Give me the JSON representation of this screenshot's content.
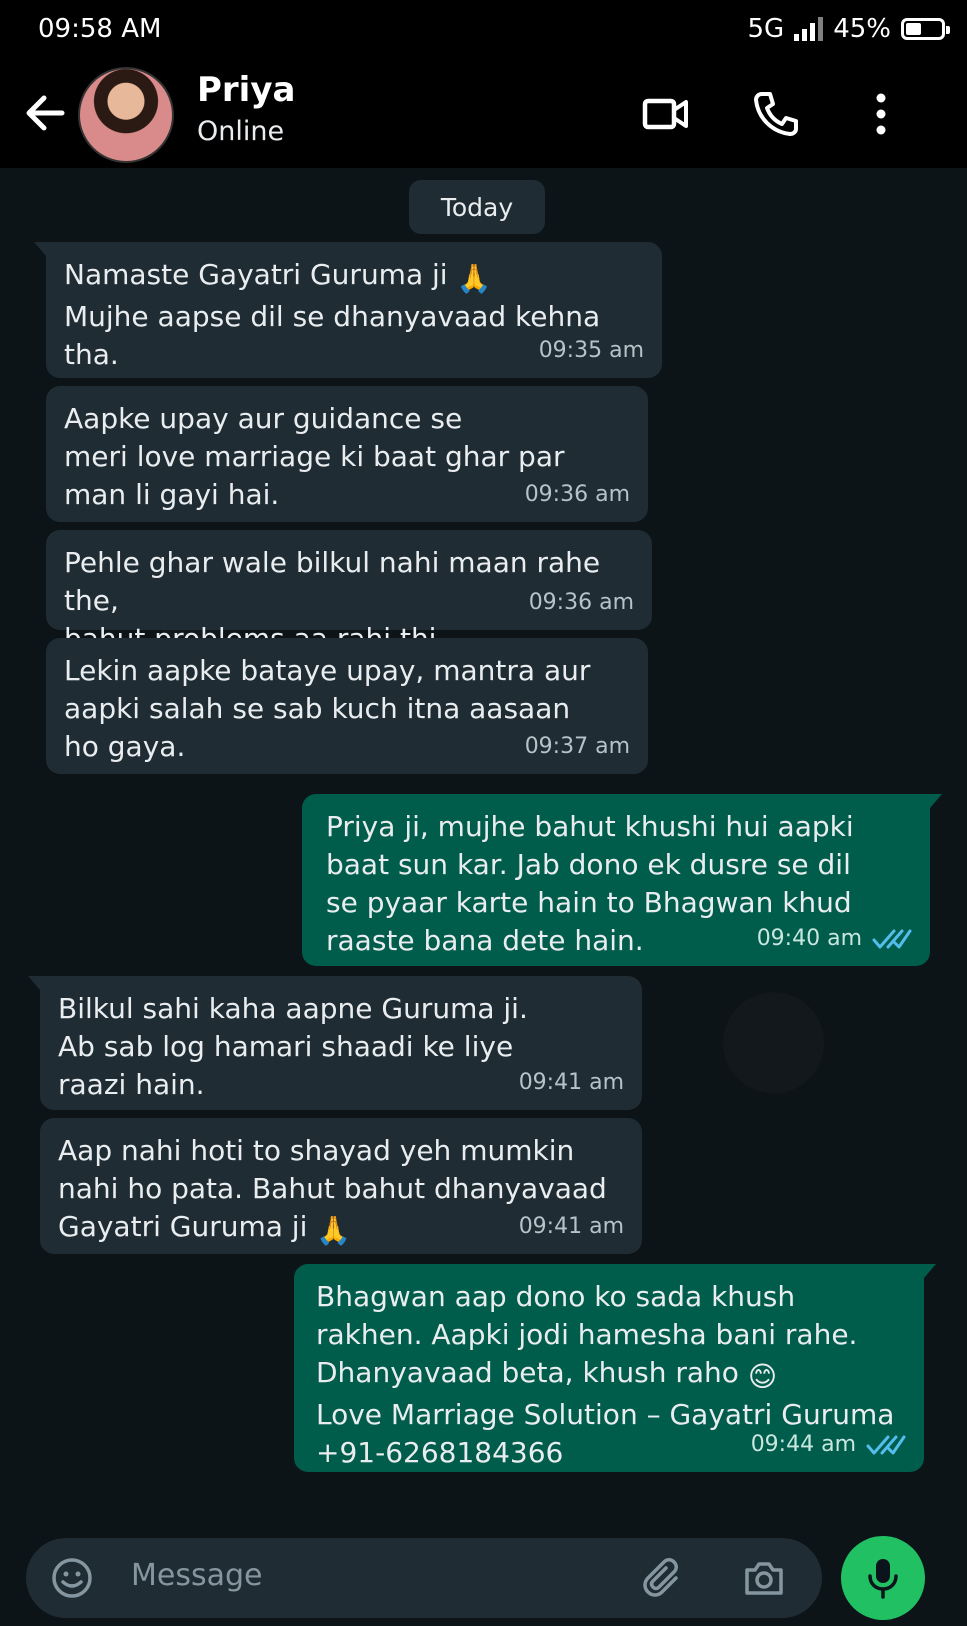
{
  "status_bar": {
    "time": "09:58 AM",
    "network": "5G",
    "battery": "45%",
    "battery_level": 0.45
  },
  "header": {
    "contact_name": "Priya",
    "presence": "Online"
  },
  "chat": {
    "date_divider": "Today",
    "messages": [
      {
        "direction": "in",
        "text": "Namaste Gayatri Guruma ji ",
        "emoji": "🙏",
        "text2": "\nMujhe aapse dil se dhanyavaad kehna tha.",
        "time": "09:35 am"
      },
      {
        "direction": "in",
        "text": "Aapke upay aur guidance se\nmeri love marriage ki baat ghar par\nman li gayi hai.",
        "time": "09:36 am"
      },
      {
        "direction": "in",
        "text": "Pehle ghar wale bilkul nahi maan rahe the,\nbahut problems aa rahi thi.",
        "time": "09:36 am"
      },
      {
        "direction": "in",
        "text": "Lekin aapke bataye upay, mantra aur\naapki salah se sab kuch itna aasaan\nho gaya.",
        "time": "09:37 am"
      },
      {
        "direction": "out",
        "text": "Priya ji, mujhe bahut khushi hui aapki\nbaat sun kar. Jab dono ek dusre se dil\nse pyaar karte hain to Bhagwan khud\nraaste bana dete hain.",
        "time": "09:40 am",
        "status": "read"
      },
      {
        "direction": "in",
        "text": "Bilkul sahi kaha aapne Guruma ji.\nAb sab log hamari shaadi ke liye\nraazi hain.",
        "time": "09:41 am"
      },
      {
        "direction": "in",
        "text": "Aap nahi hoti to shayad yeh mumkin\nnahi ho pata. Bahut bahut dhanyavaad\nGayatri Guruma ji ",
        "emoji": "🙏",
        "time": "09:41 am"
      },
      {
        "direction": "out",
        "text": "Bhagwan aap dono ko sada khush\nrakhen. Aapki jodi hamesha bani rahe.\nDhanyavaad beta, khush raho ",
        "emoji": "😊",
        "text2": "\nLove Marriage Solution – Gayatri Guruma\n+91-6268184366",
        "time": "09:44 am",
        "status": "read"
      }
    ]
  },
  "composer": {
    "placeholder": "Message"
  },
  "colors": {
    "incoming": "#1f2c33",
    "outgoing": "#005c4b",
    "accent": "#21c063",
    "read_ticks": "#53bdeb"
  }
}
